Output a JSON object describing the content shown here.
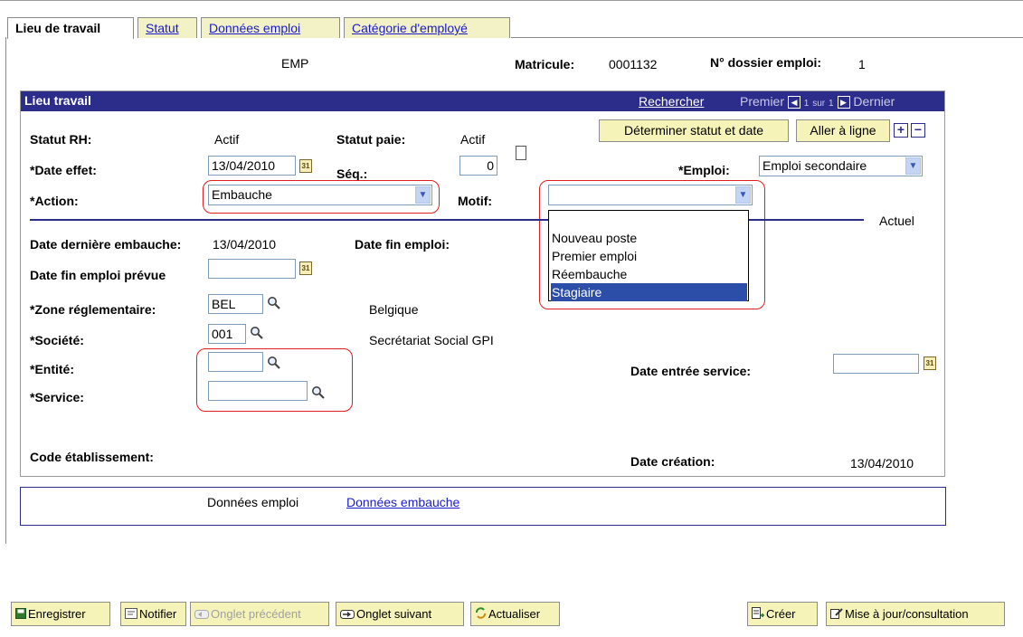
{
  "tabs": [
    {
      "label": "Lieu de travail",
      "active": true
    },
    {
      "label": "Statut",
      "active": false
    },
    {
      "label": "Données emploi",
      "active": false
    },
    {
      "label": "Catégorie d'employé",
      "active": false
    }
  ],
  "header": {
    "company": "EMP",
    "matricule_label": "Matricule:",
    "matricule_value": "0001132",
    "dossier_label": "N° dossier emploi:",
    "dossier_value": "1"
  },
  "section": {
    "title": "Lieu travail",
    "search_link": "Rechercher",
    "first": "Premier",
    "page_info_prefix": "1",
    "page_info_sur": "sur",
    "page_info_suffix": "1",
    "last": "Dernier"
  },
  "buttons": {
    "determine": "Déterminer statut et date",
    "goto_line": "Aller à ligne",
    "add": "+",
    "remove": "−"
  },
  "fields": {
    "statut_rh_label": "Statut RH:",
    "statut_rh_value": "Actif",
    "statut_paie_label": "Statut paie:",
    "statut_paie_value": "Actif",
    "date_effet_label": "*Date effet:",
    "date_effet_value": "13/04/2010",
    "seq_label": "Séq.:",
    "seq_value": "0",
    "emploi_label": "*Emploi:",
    "emploi_value": "Emploi secondaire",
    "action_label": "*Action:",
    "action_value": "Embauche",
    "motif_label": "Motif:",
    "motif_value": "",
    "actuel": "Actuel",
    "date_derniere_embauche_label": "Date dernière embauche:",
    "date_derniere_embauche_value": "13/04/2010",
    "date_fin_emploi_label": "Date fin emploi:",
    "date_fin_prevue_label": "Date fin emploi prévue",
    "date_fin_prevue_value": "",
    "zone_label": "*Zone réglementaire:",
    "zone_value": "BEL",
    "zone_desc": "Belgique",
    "societe_label": "*Société:",
    "societe_value": "001",
    "societe_desc": "Secrétariat Social GPI",
    "entite_label": "*Entité:",
    "entite_value": "",
    "service_label": "*Service:",
    "service_value": "",
    "date_entree_label": "Date entrée service:",
    "date_entree_value": "",
    "code_etab_label": "Code établissement:",
    "date_creation_label": "Date création:",
    "date_creation_value": "13/04/2010"
  },
  "motif_dropdown": {
    "options": [
      "",
      "Nouveau poste",
      "Premier emploi",
      "Réembauche",
      "Stagiaire"
    ],
    "highlighted": "Stagiaire"
  },
  "links_box": {
    "current": "Données emploi",
    "link": "Données embauche"
  },
  "footer": {
    "save": "Enregistrer",
    "notify": "Notifier",
    "prev_tab": "Onglet précédent",
    "next_tab": "Onglet suivant",
    "refresh": "Actualiser",
    "create": "Créer",
    "update": "Mise à jour/consultation"
  },
  "icons": {
    "calendar": "calendar-icon",
    "lookup": "magnifier-icon",
    "dropdown": "chevron-down-icon",
    "notes": "notepad-icon"
  },
  "colors": {
    "header_bg": "#2c2c8a",
    "button_bg": "#f5f3b8",
    "highlight": "#e02020",
    "selection": "#2c4ea8",
    "link": "#1a1acc"
  }
}
